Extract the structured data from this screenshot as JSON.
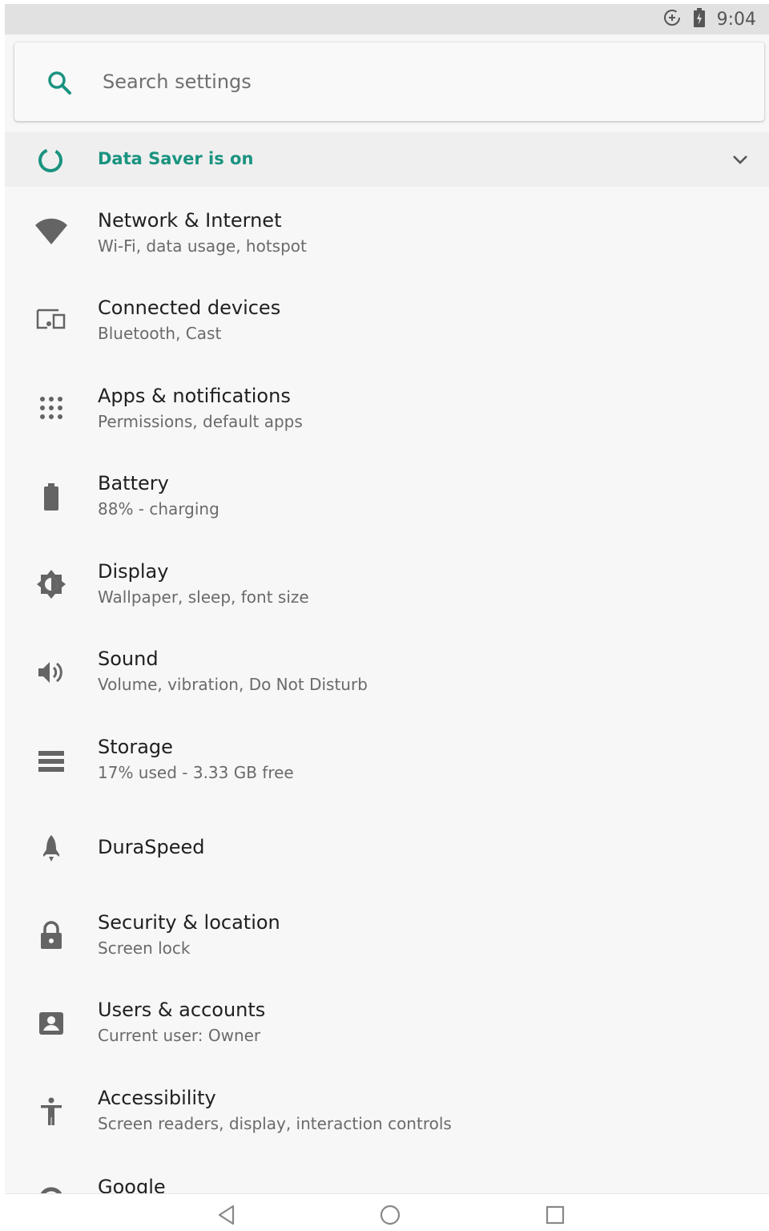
{
  "status_bar": {
    "time": "9:04",
    "icons": [
      "data-saver-icon",
      "battery-charging-icon"
    ]
  },
  "search": {
    "placeholder": "Search settings",
    "icon": "search-icon"
  },
  "data_saver": {
    "label": "Data Saver is on",
    "icon": "data-saver-icon",
    "accent": "#1a9380"
  },
  "items": [
    {
      "title": "Network & Internet",
      "subtitle": "Wi-Fi, data usage, hotspot",
      "icon": "wifi-icon"
    },
    {
      "title": "Connected devices",
      "subtitle": "Bluetooth, Cast",
      "icon": "devices-icon"
    },
    {
      "title": "Apps & notifications",
      "subtitle": "Permissions, default apps",
      "icon": "apps-icon"
    },
    {
      "title": "Battery",
      "subtitle": "88% - charging",
      "icon": "battery-icon"
    },
    {
      "title": "Display",
      "subtitle": "Wallpaper, sleep, font size",
      "icon": "brightness-icon"
    },
    {
      "title": "Sound",
      "subtitle": "Volume, vibration, Do Not Disturb",
      "icon": "volume-icon"
    },
    {
      "title": "Storage",
      "subtitle": "17% used - 3.33 GB free",
      "icon": "storage-icon"
    },
    {
      "title": "DuraSpeed",
      "subtitle": "",
      "icon": "rocket-icon"
    },
    {
      "title": "Security & location",
      "subtitle": "Screen lock",
      "icon": "lock-icon"
    },
    {
      "title": "Users & accounts",
      "subtitle": "Current user: Owner",
      "icon": "account-icon"
    },
    {
      "title": "Accessibility",
      "subtitle": "Screen readers, display, interaction controls",
      "icon": "accessibility-icon"
    },
    {
      "title": "Google",
      "subtitle": "",
      "icon": "google-icon"
    }
  ],
  "nav": {
    "buttons": [
      "back-icon",
      "home-icon",
      "recents-icon"
    ]
  }
}
